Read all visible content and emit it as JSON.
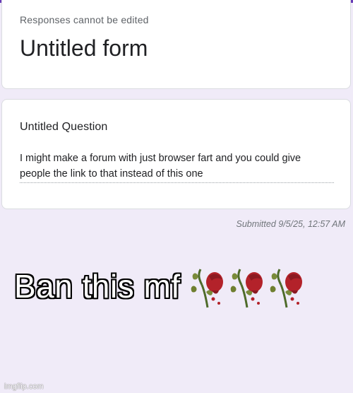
{
  "form": {
    "notice": "Responses cannot be edited",
    "title": "Untitled form"
  },
  "question": {
    "title": "Untitled Question",
    "answer": "I might make a forum with just browser fart and you could give people the link to that instead of this one"
  },
  "submission": {
    "timestamp": "Submitted 9/5/25, 12:57 AM"
  },
  "meme": {
    "caption": "Ban this mf",
    "icons": [
      "wilted-rose-icon",
      "wilted-rose-icon",
      "wilted-rose-icon"
    ]
  },
  "watermark": "imgflip.com",
  "colors": {
    "accent": "#673ab7",
    "background": "#f0ebf8"
  }
}
